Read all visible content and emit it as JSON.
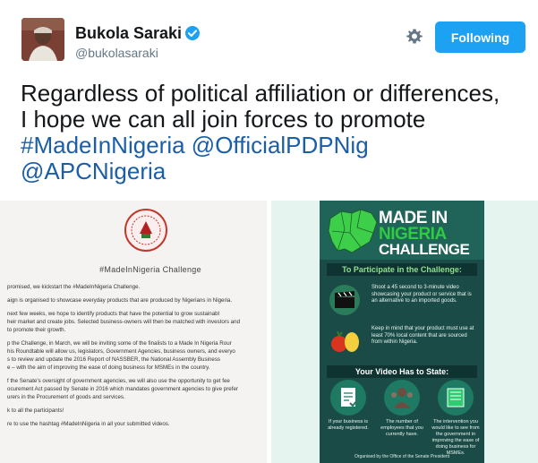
{
  "header": {
    "display_name": "Bukola Saraki",
    "handle": "@bukolasaraki",
    "follow_label": "Following"
  },
  "tweet": {
    "line1": "Regardless of political affiliation or differences,",
    "line2": "I hope we can all join forces to promote",
    "hashtag": "#MadeInNigeria",
    "mention1": "@OfficialPDPNig",
    "mention2": "@APCNigeria"
  },
  "letter": {
    "title": "#MadeInNigeria Challenge",
    "lines": [
      "promised, we kickstart the #MadeInNigeria Challenge.",
      "aign is organised to showcase everyday products that are produced by Nigerians in Nigeria.",
      "next few weeks, we hope to identify products that have the potential to grow sustainabl",
      "heir market and create jobs. Selected business-owners will then be matched with investors and",
      "to promote their growth.",
      "p the Challenge, in March, we will be inviting some of the finalists to a Made In Nigeria Rour",
      "his Roundtable will allow us, legislators, Government Agencies, business owners, and everyo",
      "s to review and update the 2016 Report of NASSBER, the National Assembly Business",
      "e – with the aim of improving the ease of doing business for MSMEs in the country.",
      "f the Senate's oversight of government agencies, we will also use the opportunity to get fee",
      "ocurement Act passed by Senate in 2016 which mandates government agencies to give prefer",
      "urers in the Procurement of goods and services.",
      "k to all the participants!",
      "re to use the hashtag #MadeInNigeria in all your submitted videos."
    ]
  },
  "poster": {
    "made_in": "MADE IN",
    "nigeria": "NIGERIA",
    "challenge": "CHALLENGE",
    "participate": "To Participate in the Challenge:",
    "step1": "Shoot a 45 second to 3-minute video showcasing your product or service that is an alternative to an imported goods.",
    "step2": "Keep in mind that your product must use at least 70% local content that are sourced from within Nigeria.",
    "video_state": "Your Video Has to State:",
    "cap1": "If your business is already registered.",
    "cap2": "The number of employees that you currently have.",
    "cap3": "The intervention you would like to see from the government in improving the ease of doing business for MSMEs.",
    "organised": "Organised by the Office of the Senate President"
  },
  "colors": {
    "accent": "#1da1f2",
    "link": "#1b5ea8",
    "poster_green": "#2ecc40"
  }
}
